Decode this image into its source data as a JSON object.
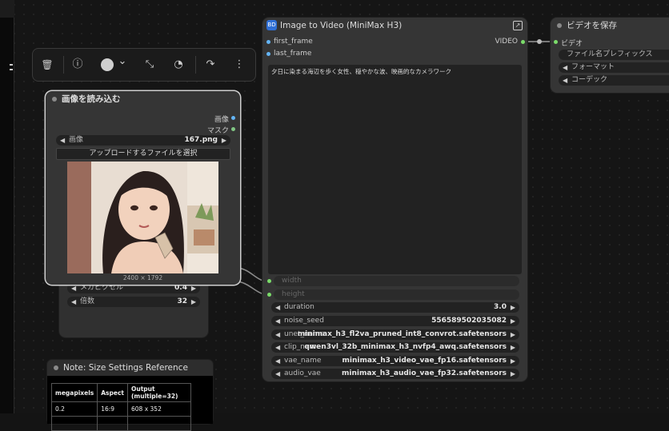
{
  "toolbar": {
    "delete": "🗑",
    "info": "ⓘ",
    "color_chevron": "⌄",
    "collapse": "⤡",
    "bypass": "◔",
    "redo": "↷",
    "more": "⋮"
  },
  "load_image_node": {
    "title": "画像を読み込む",
    "outputs": [
      "画像",
      "マスク"
    ],
    "image_widget": {
      "label": "画像",
      "value": "167.png"
    },
    "upload_button": "アップロードするファイルを選択",
    "image_size": "2400 × 1792"
  },
  "behind_node": {
    "widgets": [
      {
        "label": "メガピクセル",
        "value": "0.4"
      },
      {
        "label": "倍数",
        "value": "32"
      }
    ]
  },
  "note_node": {
    "title": "Note: Size Settings Reference",
    "table": {
      "headers": [
        "megapixels",
        "Aspect",
        "Output (multiple=32)"
      ],
      "rows": [
        [
          "0.2",
          "16:9",
          "608 x 352"
        ]
      ]
    }
  },
  "i2v_node": {
    "title": "Image to Video (MiniMax H3)",
    "inputs": [
      "first_frame",
      "last_frame"
    ],
    "output": "VIDEO",
    "prompt": "夕日に染まる海辺を歩く女性、穏やかな波、映画的なカメラワーク",
    "disabled_inputs": [
      "width",
      "height"
    ],
    "widgets": [
      {
        "label": "duration",
        "value": "3.0"
      },
      {
        "label": "noise_seed",
        "value": "556589502035082"
      },
      {
        "label": "unet_name",
        "value": "minimax_h3_fl2va_pruned_int8_convrot.safetensors"
      },
      {
        "label": "clip_name",
        "value": "qwen3vl_32b_minimax_h3_nvfp4_awq.safetensors"
      },
      {
        "label": "vae_name",
        "value": "minimax_h3_video_vae_fp16.safetensors"
      },
      {
        "label": "audio_vae",
        "value": "minimax_h3_audio_vae_fp32.safetensors"
      }
    ]
  },
  "save_video_node": {
    "title": "ビデオを保存",
    "input": "ビデオ",
    "widgets": [
      "ファイル名プレフィックス",
      "フォーマット",
      "コーデック"
    ]
  },
  "colors": {
    "node_bg": "#353535",
    "canvas_bg": "#151515",
    "image_socket": "#64b5f6",
    "mask_socket": "#81c784",
    "video_socket": "#7bdc6a",
    "api_badge": "#2f6fd6"
  }
}
